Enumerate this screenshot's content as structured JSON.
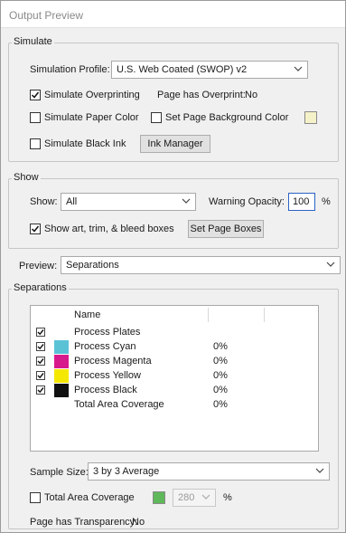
{
  "window": {
    "title": "Output Preview"
  },
  "simulate": {
    "group_label": "Simulate",
    "profile_label": "Simulation Profile:",
    "profile_value": "U.S. Web Coated (SWOP) v2",
    "overprint_label": "Simulate Overprinting",
    "overprint_checked": true,
    "page_overprint_label": "Page has Overprint:",
    "page_overprint_value": "No",
    "paper_color_label": "Simulate Paper Color",
    "bg_color_label": "Set Page Background Color",
    "bg_color": "#f5f1c8",
    "black_ink_label": "Simulate Black Ink",
    "ink_manager_label": "Ink Manager"
  },
  "show": {
    "group_label": "Show",
    "show_label": "Show:",
    "show_value": "All",
    "warning_opacity_label": "Warning Opacity:",
    "warning_opacity_value": "100",
    "percent": "%",
    "boxes_label": "Show art, trim, & bleed boxes",
    "boxes_checked": true,
    "set_page_boxes_label": "Set Page Boxes"
  },
  "preview": {
    "label": "Preview:",
    "value": "Separations"
  },
  "separations": {
    "group_label": "Separations",
    "name_header": "Name",
    "rows": [
      {
        "checked": true,
        "color": "",
        "name": "Process Plates",
        "pct": ""
      },
      {
        "checked": true,
        "color": "#5bc2d6",
        "name": "Process Cyan",
        "pct": "0%"
      },
      {
        "checked": true,
        "color": "#d81b8c",
        "name": "Process Magenta",
        "pct": "0%"
      },
      {
        "checked": true,
        "color": "#f5e800",
        "name": "Process Yellow",
        "pct": "0%"
      },
      {
        "checked": true,
        "color": "#111111",
        "name": "Process Black",
        "pct": "0%"
      },
      {
        "checked": false,
        "color": "",
        "name": "Total Area Coverage",
        "pct": "0%"
      }
    ],
    "sample_size_label": "Sample Size:",
    "sample_size_value": "3 by 3 Average",
    "tac_label": "Total Area Coverage",
    "tac_color": "#5fb85a",
    "tac_value": "280",
    "tac_percent": "%",
    "transparency_label": "Page has Transparency:",
    "transparency_value": "No"
  }
}
